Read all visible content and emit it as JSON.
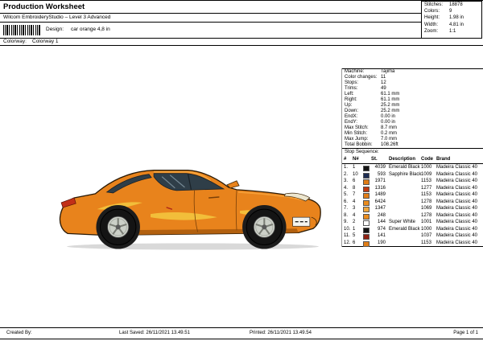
{
  "header": {
    "title": "Production Worksheet",
    "subtitle": "Wilcom EmbroideryStudio – Level 3 Advanced",
    "design_label": "Design:",
    "design_value": "car orange 4,8 in",
    "colorway_label": "Colorway:",
    "colorway_value": "Colorway 1"
  },
  "summary": {
    "rows": [
      {
        "label": "Stitches:",
        "value": "18878"
      },
      {
        "label": "Colors:",
        "value": "9"
      },
      {
        "label": "Height:",
        "value": "1.98 in"
      },
      {
        "label": "Width:",
        "value": "4.81 in"
      },
      {
        "label": "Zoom:",
        "value": "1:1"
      }
    ]
  },
  "machine": {
    "rows": [
      {
        "label": "Machine:",
        "value": "Tajima"
      },
      {
        "label": "Color changes:",
        "value": "11"
      },
      {
        "label": "Stops:",
        "value": "12"
      },
      {
        "label": "Trims:",
        "value": "49"
      },
      {
        "label": "Left:",
        "value": "61.1 mm"
      },
      {
        "label": "Right:",
        "value": "61.1 mm"
      },
      {
        "label": "Up:",
        "value": "25.2 mm"
      },
      {
        "label": "Down:",
        "value": "25.2 mm"
      },
      {
        "label": "EndX:",
        "value": "0.00 in"
      },
      {
        "label": "EndY:",
        "value": "0.00 in"
      },
      {
        "label": "Max Stitch:",
        "value": "8.7 mm"
      },
      {
        "label": "Min Stitch:",
        "value": "0.2 mm"
      },
      {
        "label": "Max Jump:",
        "value": "7.0 mm"
      },
      {
        "label": "Total Bobbin:",
        "value": "108.26ft"
      }
    ]
  },
  "stop_sequence": {
    "title": "Stop Sequence:",
    "headers": [
      "#",
      "N#",
      "St.",
      "Description",
      "Code",
      "Brand"
    ],
    "rows": [
      {
        "num": "1.",
        "needle": "1",
        "color": "#141414",
        "stitches": "4039",
        "description": "Emerald Black",
        "code": "1000",
        "brand": "Madeira Classic 40"
      },
      {
        "num": "2.",
        "needle": "10",
        "color": "#1e2d52",
        "stitches": "593",
        "description": "Sapphire Black",
        "code": "1009",
        "brand": "Madeira Classic 40"
      },
      {
        "num": "3.",
        "needle": "6",
        "color": "#e07d17",
        "stitches": "1971",
        "description": "",
        "code": "1153",
        "brand": "Madeira Classic 40"
      },
      {
        "num": "4.",
        "needle": "8",
        "color": "#c13a12",
        "stitches": "1316",
        "description": "",
        "code": "1277",
        "brand": "Madeira Classic 40"
      },
      {
        "num": "5.",
        "needle": "7",
        "color": "#e07d17",
        "stitches": "1489",
        "description": "",
        "code": "1153",
        "brand": "Madeira Classic 40"
      },
      {
        "num": "6.",
        "needle": "4",
        "color": "#ea8c1e",
        "stitches": "6424",
        "description": "",
        "code": "1278",
        "brand": "Madeira Classic 40"
      },
      {
        "num": "7.",
        "needle": "3",
        "color": "#f0a63c",
        "stitches": "1347",
        "description": "",
        "code": "1069",
        "brand": "Madeira Classic 40"
      },
      {
        "num": "8.",
        "needle": "4",
        "color": "#ea8c1e",
        "stitches": "248",
        "description": "",
        "code": "1278",
        "brand": "Madeira Classic 40"
      },
      {
        "num": "9.",
        "needle": "2",
        "color": "#ffffff",
        "stitches": "144",
        "description": "Super White",
        "code": "1001",
        "brand": "Madeira Classic 40"
      },
      {
        "num": "10.",
        "needle": "1",
        "color": "#141414",
        "stitches": "974",
        "description": "Emerald Black",
        "code": "1000",
        "brand": "Madeira Classic 40"
      },
      {
        "num": "11.",
        "needle": "5",
        "color": "#8f2011",
        "stitches": "141",
        "description": "",
        "code": "1037",
        "brand": "Madeira Classic 40"
      },
      {
        "num": "12.",
        "needle": "6",
        "color": "#e07d17",
        "stitches": "190",
        "description": "",
        "code": "1153",
        "brand": "Madeira Classic 40"
      }
    ]
  },
  "footer": {
    "created_by": "Created By:",
    "last_saved": "Last Saved: 26/11/2021 13.49.51",
    "printed": "Printed: 26/11/2021 13.49.54",
    "page": "Page 1 of 1"
  }
}
